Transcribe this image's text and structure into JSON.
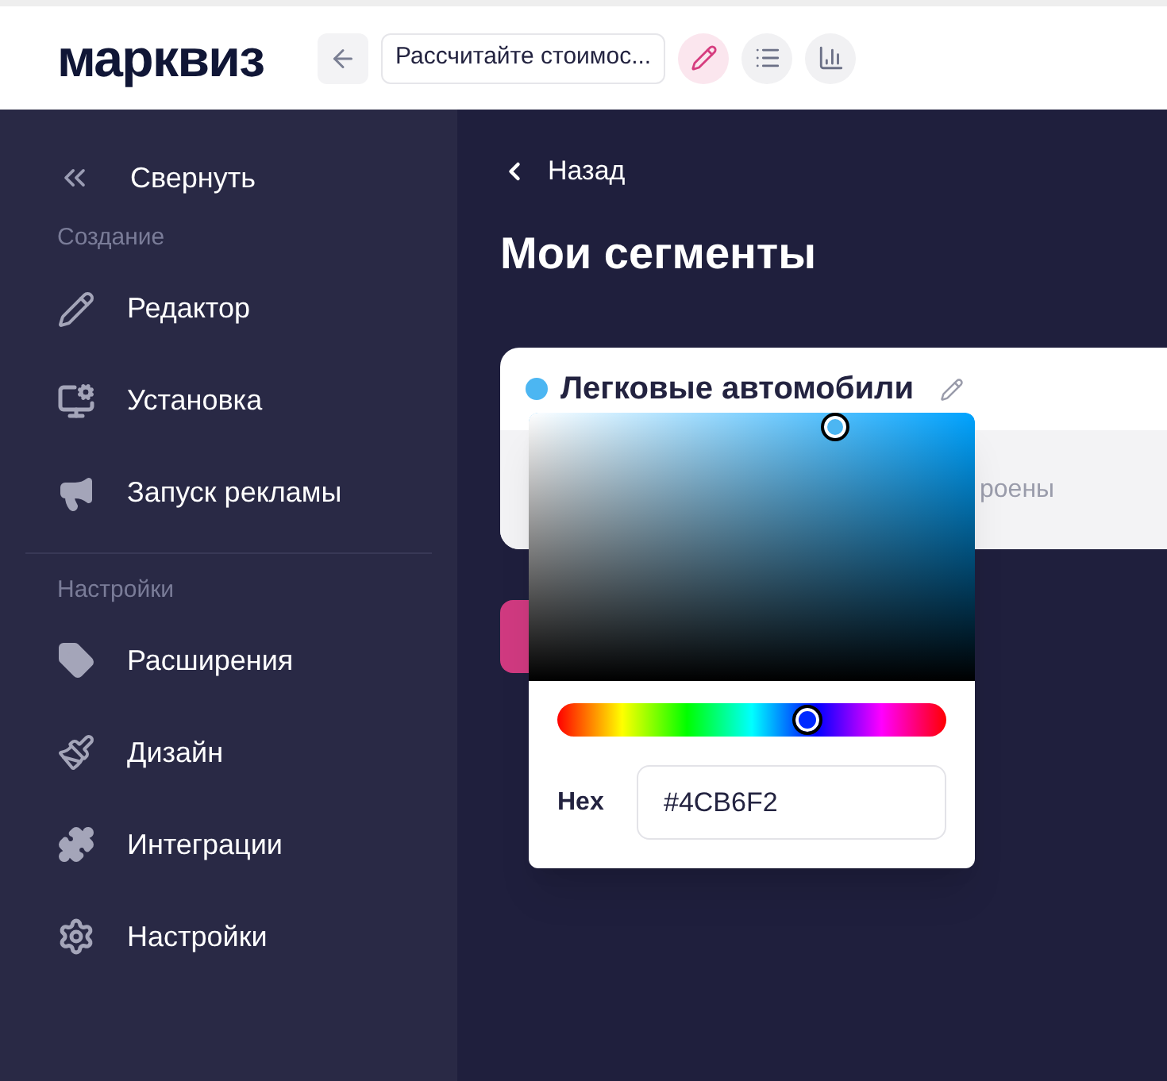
{
  "header": {
    "logo": "марквиз",
    "quiz_title": "Рассчитайте стоимос...",
    "tools": [
      {
        "kind": "edit",
        "selected": true
      },
      {
        "kind": "list",
        "selected": false
      },
      {
        "kind": "stats",
        "selected": false
      }
    ]
  },
  "sidebar": {
    "collapse": "Свернуть",
    "sections": [
      {
        "title": "Создание",
        "items": [
          {
            "kind": "pencil",
            "label": "Редактор"
          },
          {
            "kind": "install",
            "label": "Установка"
          },
          {
            "kind": "megaphone",
            "label": "Запуск рекламы"
          }
        ]
      },
      {
        "title": "Настройки",
        "items": [
          {
            "kind": "extension",
            "label": "Расширения"
          },
          {
            "kind": "brush",
            "label": "Дизайн"
          },
          {
            "kind": "integration",
            "label": "Интеграции"
          },
          {
            "kind": "gear",
            "label": "Настройки"
          }
        ]
      }
    ]
  },
  "main": {
    "back": "Назад",
    "title": "Мои сегменты",
    "segment": {
      "name": "Легковые автомобили",
      "color": "#4cb6f2",
      "note": "роены"
    }
  },
  "color_picker": {
    "hue": {
      "level": 0.64
    },
    "hex_label": "Hex",
    "hex": "#4CB6F2"
  }
}
